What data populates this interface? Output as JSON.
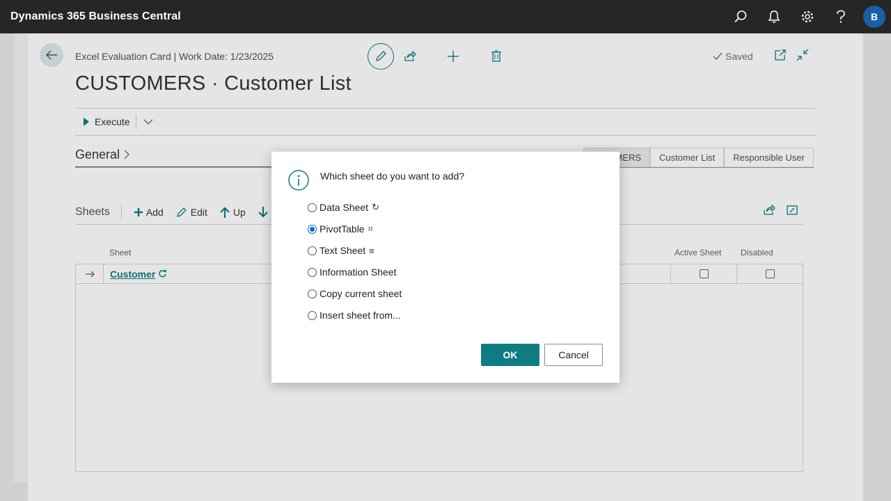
{
  "app": {
    "title": "Dynamics 365 Business Central",
    "user_initial": "B"
  },
  "header": {
    "caption": "Excel Evaluation Card | Work Date: 1/23/2025",
    "saved_label": "Saved",
    "page_title": "CUSTOMERS · Customer List"
  },
  "actions": {
    "execute_label": "Execute"
  },
  "general": {
    "label": "General"
  },
  "tabs": [
    "MERS",
    "Customer List",
    "Responsible User"
  ],
  "sheets": {
    "title": "Sheets",
    "add_label": "Add",
    "edit_label": "Edit",
    "up_label": "Up"
  },
  "grid": {
    "col_sheet": "Sheet",
    "col_active": "Active Sheet",
    "col_disabled": "Disabled",
    "rows": [
      {
        "name": "Customer"
      }
    ]
  },
  "dialog": {
    "prompt": "Which sheet do you want to add?",
    "selected": "PivotTable",
    "options": [
      {
        "label": "Data Sheet",
        "glyph": "↻"
      },
      {
        "label": "PivotTable",
        "glyph": "⌗"
      },
      {
        "label": "Text Sheet",
        "glyph": "≡"
      },
      {
        "label": "Information Sheet",
        "glyph": ""
      },
      {
        "label": "Copy current sheet",
        "glyph": ""
      },
      {
        "label": "Insert sheet from...",
        "glyph": ""
      }
    ],
    "ok_label": "OK",
    "cancel_label": "Cancel"
  },
  "colors": {
    "accent": "#0f7b83",
    "appbar": "#262626",
    "avatar": "#1a5fa8",
    "radio_selected": "#0a64d6"
  },
  "icons": [
    "search-icon",
    "bell-icon",
    "gear-icon",
    "help-icon",
    "back-arrow-icon",
    "pencil-icon",
    "share-icon",
    "plus-icon",
    "trash-icon",
    "checkmark-icon",
    "open-new-window-icon",
    "collapse-icon",
    "info-icon"
  ]
}
